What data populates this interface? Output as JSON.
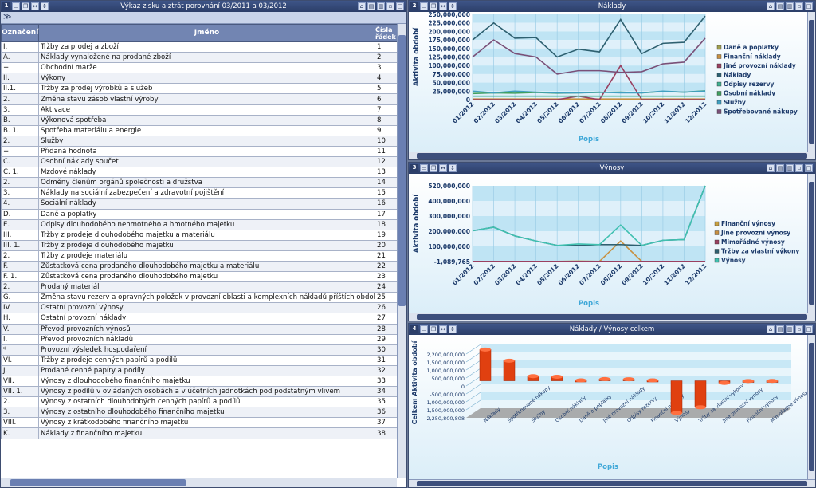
{
  "left": {
    "title": "Výkaz zisku a ztrát porovnání 03/2011 a 03/2012",
    "collapse_label": "≫",
    "columns": [
      "Označení",
      "Jméno",
      "Čísla řádek"
    ],
    "rows": [
      [
        "I.",
        "Tržby za prodej a zboží",
        "1"
      ],
      [
        "A.",
        "Náklady vynaložené na prodané zboží",
        "2"
      ],
      [
        "+",
        "Obchodní marže",
        "3"
      ],
      [
        "II.",
        "Výkony",
        "4"
      ],
      [
        "II.1.",
        "Tržby za prodej výrobků a služeb",
        "5"
      ],
      [
        "2.",
        "Změna stavu zásob vlastní výroby",
        "6"
      ],
      [
        "3.",
        "Aktivace",
        "7"
      ],
      [
        "B.",
        "Výkonová spotřeba",
        "8"
      ],
      [
        "B. 1.",
        "Spotřeba materiálu a energie",
        "9"
      ],
      [
        "2.",
        "Služby",
        "10"
      ],
      [
        "+",
        "Přidaná hodnota",
        "11"
      ],
      [
        "C.",
        "Osobní náklady součet",
        "12"
      ],
      [
        "C. 1.",
        "Mzdové náklady",
        "13"
      ],
      [
        "2.",
        "Odměny členům orgánů společnosti a družstva",
        "14"
      ],
      [
        "3.",
        "Náklady na sociální zabezpečení a zdravotní pojištění",
        "15"
      ],
      [
        "4.",
        "Sociální náklady",
        "16"
      ],
      [
        "D.",
        "Daně a poplatky",
        "17"
      ],
      [
        "E.",
        "Odpisy dlouhodobého nehmotného a hmotného majetku",
        "18"
      ],
      [
        "III.",
        "Tržby z prodeje dlouhodobého majetku a materiálu",
        "19"
      ],
      [
        "III. 1.",
        "Tržby z prodeje dlouhodobého majetku",
        "20"
      ],
      [
        "2.",
        "Tržby z prodeje materiálu",
        "21"
      ],
      [
        "F.",
        "Zůstatková cena prodaného dlouhodobého majetku a materiálu",
        "22"
      ],
      [
        "F. 1.",
        "Zůstatková cena prodaného dlouhodobého majetku",
        "23"
      ],
      [
        "2.",
        "Prodaný materiál",
        "24"
      ],
      [
        "G.",
        "Změna stavu rezerv a opravných položek v provozní oblasti a komplexních nákladů příštích období",
        "25"
      ],
      [
        "IV.",
        "Ostatní provozní výnosy",
        "26"
      ],
      [
        "H.",
        "Ostatní provozní náklady",
        "27"
      ],
      [
        "V.",
        "Převod provozních výnosů",
        "28"
      ],
      [
        "I.",
        "Převod provozních nákladů",
        "29"
      ],
      [
        "*",
        "Provozní výsledek hospodaření",
        "30"
      ],
      [
        "VI.",
        "Tržby z prodeje cenných papírů a podílů",
        "31"
      ],
      [
        "J.",
        "Prodané cenné papíry a podíly",
        "32"
      ],
      [
        "VII.",
        "Výnosy z dlouhodobého finančního majetku",
        "33"
      ],
      [
        "VII. 1.",
        "Výnosy z podílů v ovládaných osobách a v účetních jednotkách pod podstatným vlivem",
        "34"
      ],
      [
        "2.",
        "Výnosy z ostatních dlouhodobých cenných papírů a podílů",
        "35"
      ],
      [
        "3.",
        "Výnosy z ostatního dlouhodobého finančního majetku",
        "36"
      ],
      [
        "VIII.",
        "Výnosy z krátkodobého finančního majetku",
        "37"
      ],
      [
        "K.",
        "Náklady z finančního majetku",
        "38"
      ]
    ]
  },
  "panes": [
    {
      "num": "2",
      "title": "Náklady"
    },
    {
      "num": "3",
      "title": "Výnosy"
    },
    {
      "num": "4",
      "title": "Náklady / Výnosy celkem"
    }
  ],
  "chart_data": [
    {
      "type": "line",
      "title": "Náklady",
      "xlabel": "Popis",
      "ylabel": "Aktivita období",
      "x": [
        "01/2012",
        "02/2012",
        "03/2012",
        "04/2012",
        "05/2012",
        "06/2012",
        "07/2012",
        "08/2012",
        "09/2012",
        "10/2012",
        "11/2012",
        "12/2012"
      ],
      "yticks": [
        "0",
        "25,000,000",
        "50,000,000",
        "75,000,000",
        "100,000,000",
        "125,000,000",
        "150,000,000",
        "175,000,000",
        "200,000,000",
        "225,000,000",
        "250,000,000"
      ],
      "ylim": [
        0,
        250000000
      ],
      "series": [
        {
          "name": "Daně a poplatky",
          "color": "#a0a050",
          "values": [
            1000000,
            1000000,
            1000000,
            1000000,
            1000000,
            1000000,
            1000000,
            1000000,
            1000000,
            1000000,
            1000000,
            1000000
          ]
        },
        {
          "name": "Finanční náklady",
          "color": "#c89040",
          "values": [
            2000000,
            2000000,
            2000000,
            2000000,
            2000000,
            2000000,
            2000000,
            2000000,
            2000000,
            2000000,
            2000000,
            2000000
          ]
        },
        {
          "name": "Jiné provozní náklady",
          "color": "#9a4060",
          "values": [
            0,
            0,
            0,
            0,
            0,
            10000000,
            0,
            100000000,
            0,
            0,
            0,
            0
          ]
        },
        {
          "name": "Náklady",
          "color": "#2e6070",
          "values": [
            175000000,
            225000000,
            180000000,
            182000000,
            125000000,
            148000000,
            140000000,
            235000000,
            135000000,
            165000000,
            168000000,
            245000000
          ]
        },
        {
          "name": "Odpisy rezervy",
          "color": "#40b090",
          "values": [
            10000000,
            10000000,
            10000000,
            10000000,
            10000000,
            10000000,
            10000000,
            10000000,
            10000000,
            10000000,
            10000000,
            10000000
          ]
        },
        {
          "name": "Osobní náklady",
          "color": "#40a060",
          "values": [
            18000000,
            20000000,
            19000000,
            21000000,
            19000000,
            20000000,
            21000000,
            22000000,
            20000000,
            24000000,
            22000000,
            26000000
          ]
        },
        {
          "name": "Služby",
          "color": "#40a0c0",
          "values": [
            25000000,
            20000000,
            25000000,
            22000000,
            20000000,
            20000000,
            22000000,
            20000000,
            20000000,
            25000000,
            22000000,
            25000000
          ]
        },
        {
          "name": "Spotřebované nákupy",
          "color": "#7a5078",
          "values": [
            125000000,
            175000000,
            135000000,
            125000000,
            75000000,
            85000000,
            85000000,
            80000000,
            82000000,
            105000000,
            110000000,
            180000000
          ]
        }
      ]
    },
    {
      "type": "line",
      "title": "Výnosy",
      "xlabel": "Popis",
      "ylabel": "Aktivita období",
      "x": [
        "01/2012",
        "02/2012",
        "03/2012",
        "04/2012",
        "05/2012",
        "06/2012",
        "07/2012",
        "08/2012",
        "09/2012",
        "10/2012",
        "11/2012",
        "12/2012"
      ],
      "yticks": [
        "-1,089,765",
        "100,000,000",
        "200,000,000",
        "300,000,000",
        "400,000,000",
        "520,000,000"
      ],
      "ylim": [
        -1089765,
        520000000
      ],
      "series": [
        {
          "name": "Finanční výnosy",
          "color": "#c8a040",
          "values": [
            0,
            0,
            0,
            0,
            0,
            2000000,
            0,
            0,
            0,
            0,
            0,
            0
          ]
        },
        {
          "name": "Jiné provozní výnosy",
          "color": "#c89040",
          "values": [
            0,
            0,
            0,
            0,
            0,
            0,
            0,
            140000000,
            0,
            0,
            0,
            0
          ]
        },
        {
          "name": "Mimořádné výnosy",
          "color": "#9a4060",
          "values": [
            0,
            0,
            0,
            0,
            0,
            0,
            0,
            0,
            0,
            0,
            0,
            0
          ]
        },
        {
          "name": "Tržby za vlastní výkony",
          "color": "#2e6070",
          "values": [
            210000000,
            235000000,
            175000000,
            140000000,
            110000000,
            110000000,
            115000000,
            115000000,
            110000000,
            145000000,
            150000000,
            520000000
          ]
        },
        {
          "name": "Výnosy",
          "color": "#40c0b0",
          "values": [
            210000000,
            235000000,
            175000000,
            140000000,
            110000000,
            120000000,
            115000000,
            250000000,
            110000000,
            145000000,
            150000000,
            520000000
          ]
        }
      ]
    },
    {
      "type": "bar",
      "title": "Náklady / Výnosy celkem",
      "xlabel": "Popis",
      "ylabel": "Celkem Aktivita období",
      "yticks": [
        "2,200,000,000",
        "1,500,000,000",
        "1,000,000,000",
        "500,000,000",
        "0",
        "-500,000,000",
        "-1,000,000,000",
        "-1,500,000,000",
        "-2,250,800,808"
      ],
      "ylim": [
        -2250800808,
        2200000000
      ],
      "categories": [
        "Náklady",
        "Spotřebované nákupy",
        "Služby",
        "Osobní náklady",
        "Daně a poplatky",
        "Jiné provozní náklady",
        "Odpisy  rezervy",
        "Finanční náklady",
        "Výnosy",
        "Tržby za vlastní výkony",
        "Jiné provozní výnosy",
        "Finanční výnosy",
        "Mimořádné výnosy"
      ],
      "values": [
        2180000000,
        1400000000,
        320000000,
        280000000,
        30000000,
        120000000,
        110000000,
        30000000,
        -2250000000,
        -1850000000,
        -150000000,
        -15000000,
        -10000000
      ],
      "color": "#e04010"
    }
  ]
}
